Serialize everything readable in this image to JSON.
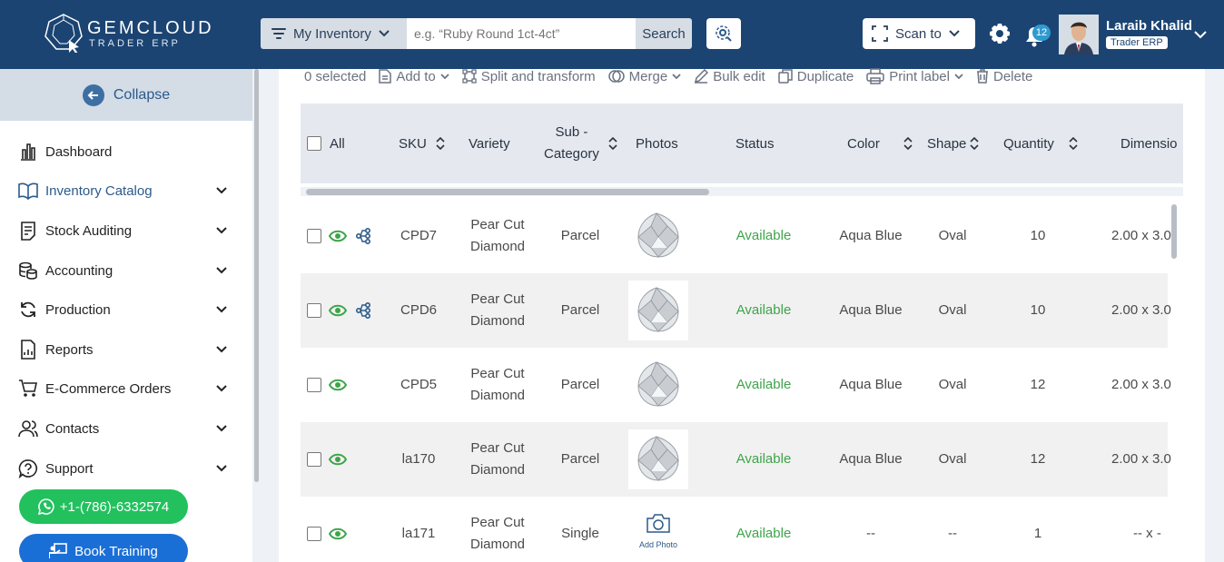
{
  "brand": {
    "name": "GEMCLOUD",
    "sub": "TRADER ERP"
  },
  "header": {
    "inventory_select": "My Inventory",
    "search_placeholder": "e.g. “Ruby Round 1ct-4ct”",
    "search_label": "Search",
    "scan_label": "Scan to",
    "notification_count": "12",
    "user_name": "Laraib Khalid",
    "user_role": "Trader ERP"
  },
  "sidebar": {
    "collapse_label": "Collapse",
    "items": [
      {
        "label": "Dashboard",
        "icon": "chart-icon",
        "has_chevron": false
      },
      {
        "label": "Inventory Catalog",
        "icon": "book-icon",
        "has_chevron": true,
        "active": true
      },
      {
        "label": "Stock Auditing",
        "icon": "clipboard-icon",
        "has_chevron": true
      },
      {
        "label": "Accounting",
        "icon": "coins-icon",
        "has_chevron": true
      },
      {
        "label": "Production",
        "icon": "refresh-icon",
        "has_chevron": true
      },
      {
        "label": "Reports",
        "icon": "report-icon",
        "has_chevron": true
      },
      {
        "label": "E-Commerce Orders",
        "icon": "cart-icon",
        "has_chevron": true
      },
      {
        "label": "Contacts",
        "icon": "contacts-icon",
        "has_chevron": true
      },
      {
        "label": "Support",
        "icon": "help-icon",
        "has_chevron": true
      }
    ],
    "phone": "+1-(786)-6332574",
    "training": "Book Training"
  },
  "toolbar": {
    "selected": "0 selected",
    "add_to": "Add to",
    "split": "Split and transform",
    "merge": "Merge",
    "bulk_edit": "Bulk edit",
    "duplicate": "Duplicate",
    "print_label": "Print label",
    "delete": "Delete"
  },
  "table": {
    "headers": {
      "all": "All",
      "sku": "SKU",
      "variety": "Variety",
      "sub_category_1": "Sub -",
      "sub_category_2": "Category",
      "photos": "Photos",
      "status": "Status",
      "color": "Color",
      "shape": "Shape",
      "quantity": "Quantity",
      "dimensions": "Dimensio"
    },
    "rows": [
      {
        "sku": "CPD7",
        "variety_1": "Pear Cut",
        "variety_2": "Diamond",
        "sub_category": "Parcel",
        "photo": "diamond",
        "status": "Available",
        "color": "Aqua Blue",
        "shape": "Oval",
        "quantity": "10",
        "dimensions": "2.00 x 3.0",
        "linked": true
      },
      {
        "sku": "CPD6",
        "variety_1": "Pear Cut",
        "variety_2": "Diamond",
        "sub_category": "Parcel",
        "photo": "diamond",
        "status": "Available",
        "color": "Aqua Blue",
        "shape": "Oval",
        "quantity": "10",
        "dimensions": "2.00 x 3.0",
        "linked": true
      },
      {
        "sku": "CPD5",
        "variety_1": "Pear Cut",
        "variety_2": "Diamond",
        "sub_category": "Parcel",
        "photo": "diamond",
        "status": "Available",
        "color": "Aqua Blue",
        "shape": "Oval",
        "quantity": "12",
        "dimensions": "2.00 x 3.0",
        "linked": false
      },
      {
        "sku": "la170",
        "variety_1": "Pear Cut",
        "variety_2": "Diamond",
        "sub_category": "Parcel",
        "photo": "diamond",
        "status": "Available",
        "color": "Aqua Blue",
        "shape": "Oval",
        "quantity": "12",
        "dimensions": "2.00 x 3.0",
        "linked": false
      },
      {
        "sku": "la171",
        "variety_1": "Pear Cut",
        "variety_2": "Diamond",
        "sub_category": "Single",
        "photo": "add",
        "photo_label": "Add Photo",
        "status": "Available",
        "color": "--",
        "shape": "--",
        "quantity": "1",
        "dimensions": "-- x -",
        "linked": false
      }
    ]
  },
  "colors": {
    "header_bg": "#1b4472",
    "status_green": "#3ea44a",
    "whatsapp": "#22c15e",
    "training": "#1a6fd6"
  }
}
